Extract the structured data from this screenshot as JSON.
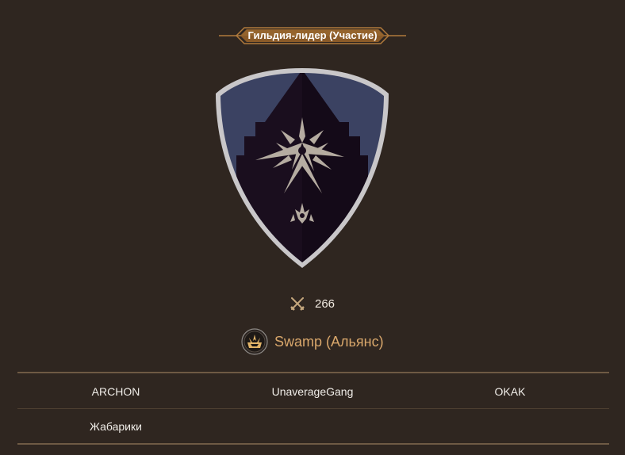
{
  "header": {
    "title": "Гильдия-лидер (Участие)"
  },
  "crest": {
    "icon": "guild-crest-shield-icon",
    "colors": {
      "outer_rim": "#c9c7c9",
      "field": "#3b4262",
      "dark": "#1a0e1e",
      "symbol": "#b5aca1"
    }
  },
  "stats": {
    "icon": "crossed-swords-icon",
    "value": "266"
  },
  "alliance": {
    "icon": "alliance-emblem-icon",
    "name": "Swamp (Альянс)",
    "color": "#d9a76b"
  },
  "members": [
    [
      "ARCHON",
      "UnaverageGang",
      "OKAK"
    ],
    [
      "Жабарики",
      "",
      ""
    ]
  ]
}
